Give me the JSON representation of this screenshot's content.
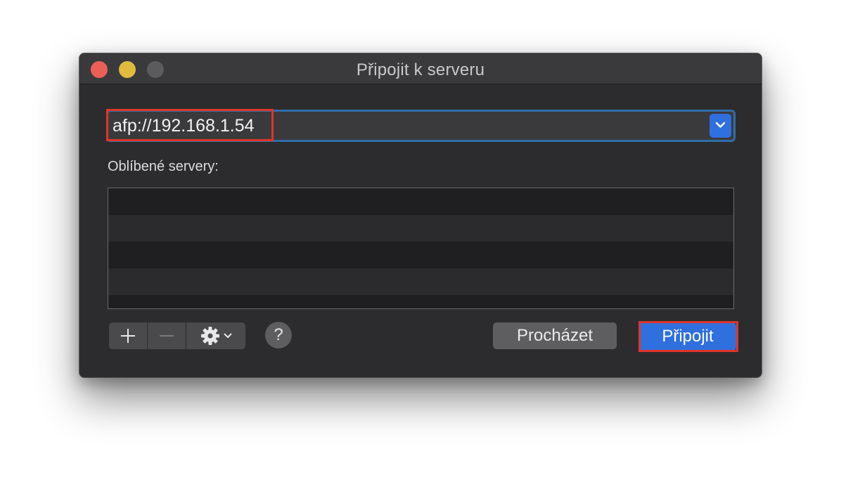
{
  "window": {
    "title": "Připojit k serveru"
  },
  "address": {
    "value": "afp://192.168.1.54",
    "dropdown_icon": "chevron-down-icon"
  },
  "favorites": {
    "label": "Oblíbené servery:",
    "rows": [
      "",
      "",
      "",
      ""
    ]
  },
  "toolbar": {
    "add_icon": "plus-icon",
    "remove_icon": "minus-icon",
    "action_icon": "gear-icon",
    "help_label": "?"
  },
  "buttons": {
    "browse_label": "Procházet",
    "connect_label": "Připojit"
  },
  "colors": {
    "accent": "#2f6fde",
    "highlight": "#e2342a",
    "window_bg": "#2c2c2e"
  }
}
